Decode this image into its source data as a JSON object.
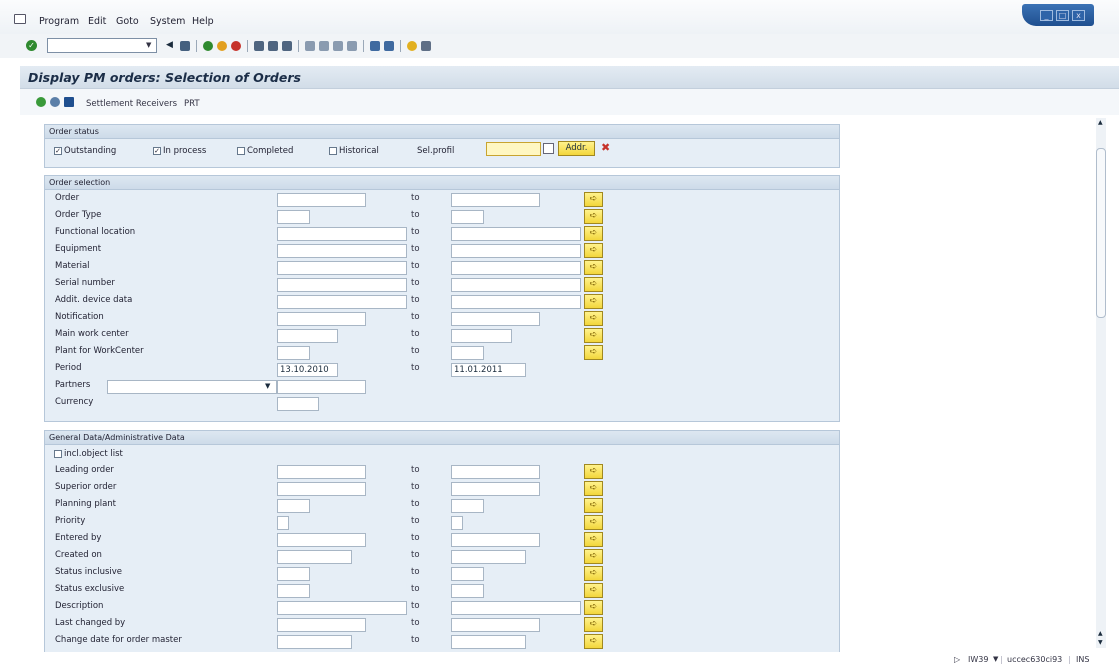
{
  "menu": [
    "Program",
    "Edit",
    "Goto",
    "System",
    "Help"
  ],
  "window_buttons": [
    "_",
    "□",
    "x"
  ],
  "title": "Display PM orders: Selection of Orders",
  "app_toolbar": {
    "settlement": "Settlement Receivers",
    "prt": "PRT"
  },
  "status_group": {
    "title": "Order status",
    "outstanding": "Outstanding",
    "in_process": "In process",
    "completed": "Completed",
    "historical": "Historical",
    "sel_profile": "Sel.profil",
    "addr_button": "Addr."
  },
  "order_selection": {
    "title": "Order selection",
    "to": "to",
    "rows": [
      {
        "label": "Order"
      },
      {
        "label": "Order Type"
      },
      {
        "label": "Functional location"
      },
      {
        "label": "Equipment"
      },
      {
        "label": "Material"
      },
      {
        "label": "Serial number"
      },
      {
        "label": "Addit. device data"
      },
      {
        "label": "Notification"
      },
      {
        "label": "Main work center"
      },
      {
        "label": "Plant for WorkCenter"
      },
      {
        "label": "Period",
        "from": "13.10.2010",
        "to_value": "11.01.2011"
      },
      {
        "label": "Partners"
      },
      {
        "label": "Currency"
      }
    ]
  },
  "general": {
    "title": "General Data/Administrative Data",
    "incl_obj": "incl.object list",
    "to": "to",
    "rows": [
      {
        "label": "Leading order"
      },
      {
        "label": "Superior order"
      },
      {
        "label": "Planning plant"
      },
      {
        "label": "Priority"
      },
      {
        "label": "Entered by"
      },
      {
        "label": "Created on"
      },
      {
        "label": "Status inclusive"
      },
      {
        "label": "Status exclusive"
      },
      {
        "label": "Description"
      },
      {
        "label": "Last changed by"
      },
      {
        "label": "Change date for order master"
      }
    ]
  },
  "status_bar": {
    "transaction": "IW39",
    "server": "uccec630ci93",
    "mode": "INS"
  },
  "colors": {
    "group_bg": "#e6eef6",
    "arrow_yellow": "#f3d63c",
    "title_text": "#1b2d47"
  }
}
